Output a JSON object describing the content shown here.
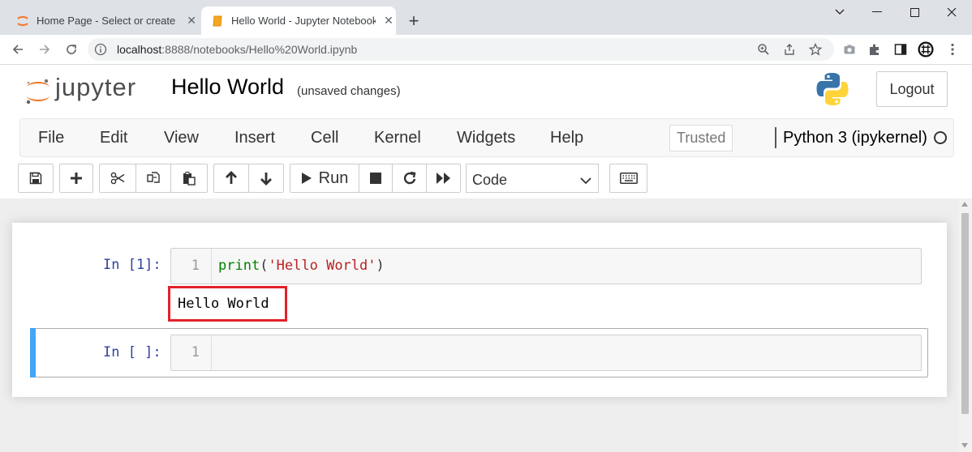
{
  "browser": {
    "tabs": [
      {
        "title": "Home Page - Select or create a",
        "active": false,
        "icon": "jupyter-tab-icon"
      },
      {
        "title": "Hello World - Jupyter Notebook",
        "active": true,
        "icon": "notebook-tab-icon"
      }
    ],
    "new_tab_icon": "plus-icon",
    "url_host": "localhost",
    "url_path": ":8888/notebooks/Hello%20World.ipynb",
    "window_controls": [
      "chevron-down-icon",
      "minimize-icon",
      "maximize-icon",
      "close-icon"
    ]
  },
  "header": {
    "logo_text": "jupyter",
    "notebook_title": "Hello World",
    "save_status": "(unsaved changes)",
    "logout_label": "Logout"
  },
  "menu": {
    "items": [
      "File",
      "Edit",
      "View",
      "Insert",
      "Cell",
      "Kernel",
      "Widgets",
      "Help"
    ],
    "trusted_label": "Trusted",
    "kernel_name": "Python 3 (ipykernel)"
  },
  "toolbar": {
    "run_label": "Run",
    "cell_type": "Code"
  },
  "cells": [
    {
      "prompt": "In [1]:",
      "line_number": "1",
      "code_fn": "print",
      "code_open": "(",
      "code_string": "'Hello World'",
      "code_close": ")",
      "output": "Hello World"
    },
    {
      "prompt": "In [ ]:",
      "line_number": "1",
      "code": ""
    }
  ],
  "colors": {
    "accent_selected_cell": "#42a5f5",
    "highlight_box": "#e3222a",
    "prompt": "#303f9f"
  }
}
